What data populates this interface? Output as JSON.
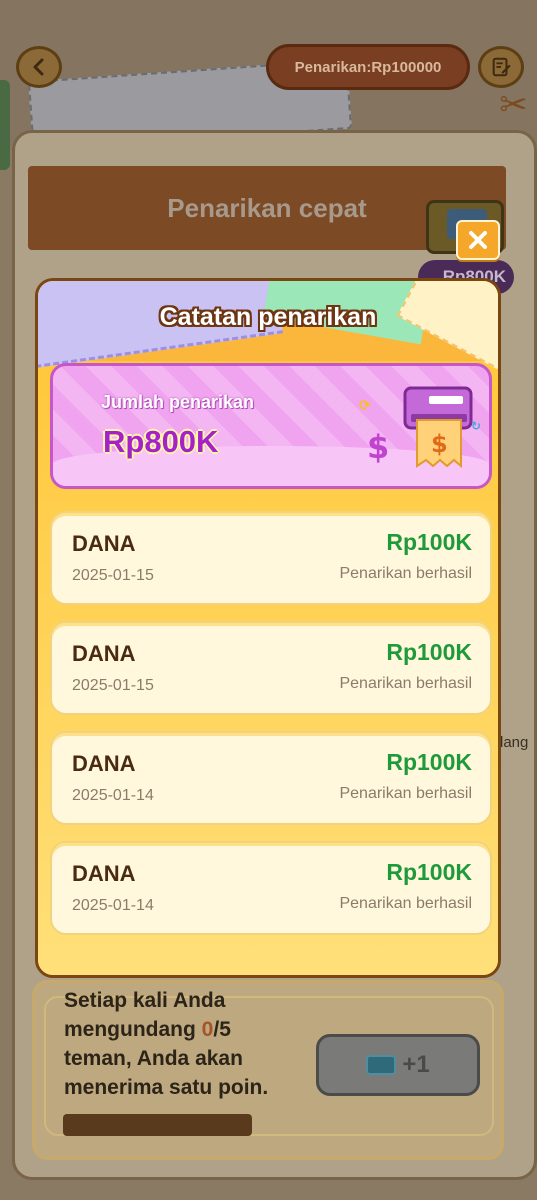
{
  "header": {
    "withdraw_pill": "Penarikan:Rp100000",
    "back_icon": "chevron-left-icon",
    "edit_icon": "edit-note-icon"
  },
  "background": {
    "ribbon_title": "Penarikan cepat",
    "gift_label": "Rp800K",
    "side_text": "lang",
    "invite": {
      "text_line1": "Setiap kali Anda",
      "text_line2_prefix": "mengundang ",
      "text_line2_count": "0",
      "text_line2_suffix": "/5",
      "text_line3": "teman, Anda akan",
      "text_line4": "menerima satu poin.",
      "button_label": "+1"
    }
  },
  "modal": {
    "title": "Catatan penarikan",
    "total_label": "Jumlah penarikan",
    "total_value": "Rp800K",
    "close_icon": "close-icon",
    "records": [
      {
        "method": "DANA",
        "date": "2025-01-15",
        "amount": "Rp100K",
        "status": "Penarikan berhasil"
      },
      {
        "method": "DANA",
        "date": "2025-01-15",
        "amount": "Rp100K",
        "status": "Penarikan berhasil"
      },
      {
        "method": "DANA",
        "date": "2025-01-14",
        "amount": "Rp100K",
        "status": "Penarikan berhasil"
      },
      {
        "method": "DANA",
        "date": "2025-01-14",
        "amount": "Rp100K",
        "status": "Penarikan berhasil"
      }
    ]
  },
  "colors": {
    "overlay_dim": "#6f6150",
    "modal_bg": "#fbd058",
    "total_card": "#f4b6f3",
    "amount_green": "#1f9a3a",
    "total_purple": "#a521c9"
  }
}
